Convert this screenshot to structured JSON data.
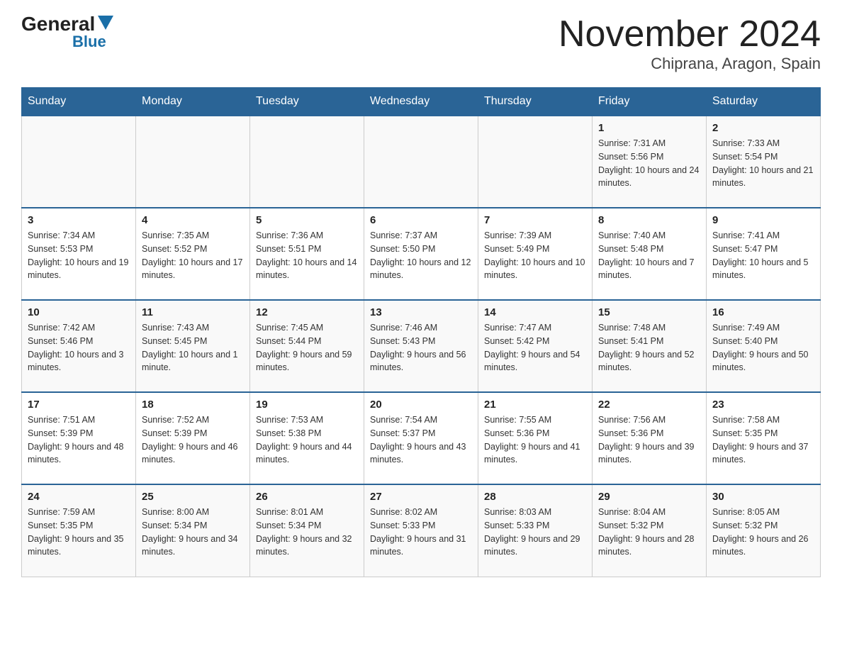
{
  "header": {
    "logo_general": "General",
    "logo_blue": "Blue",
    "title": "November 2024",
    "subtitle": "Chiprana, Aragon, Spain"
  },
  "days_of_week": [
    "Sunday",
    "Monday",
    "Tuesday",
    "Wednesday",
    "Thursday",
    "Friday",
    "Saturday"
  ],
  "weeks": [
    [
      {
        "day": "",
        "info": ""
      },
      {
        "day": "",
        "info": ""
      },
      {
        "day": "",
        "info": ""
      },
      {
        "day": "",
        "info": ""
      },
      {
        "day": "",
        "info": ""
      },
      {
        "day": "1",
        "info": "Sunrise: 7:31 AM\nSunset: 5:56 PM\nDaylight: 10 hours and 24 minutes."
      },
      {
        "day": "2",
        "info": "Sunrise: 7:33 AM\nSunset: 5:54 PM\nDaylight: 10 hours and 21 minutes."
      }
    ],
    [
      {
        "day": "3",
        "info": "Sunrise: 7:34 AM\nSunset: 5:53 PM\nDaylight: 10 hours and 19 minutes."
      },
      {
        "day": "4",
        "info": "Sunrise: 7:35 AM\nSunset: 5:52 PM\nDaylight: 10 hours and 17 minutes."
      },
      {
        "day": "5",
        "info": "Sunrise: 7:36 AM\nSunset: 5:51 PM\nDaylight: 10 hours and 14 minutes."
      },
      {
        "day": "6",
        "info": "Sunrise: 7:37 AM\nSunset: 5:50 PM\nDaylight: 10 hours and 12 minutes."
      },
      {
        "day": "7",
        "info": "Sunrise: 7:39 AM\nSunset: 5:49 PM\nDaylight: 10 hours and 10 minutes."
      },
      {
        "day": "8",
        "info": "Sunrise: 7:40 AM\nSunset: 5:48 PM\nDaylight: 10 hours and 7 minutes."
      },
      {
        "day": "9",
        "info": "Sunrise: 7:41 AM\nSunset: 5:47 PM\nDaylight: 10 hours and 5 minutes."
      }
    ],
    [
      {
        "day": "10",
        "info": "Sunrise: 7:42 AM\nSunset: 5:46 PM\nDaylight: 10 hours and 3 minutes."
      },
      {
        "day": "11",
        "info": "Sunrise: 7:43 AM\nSunset: 5:45 PM\nDaylight: 10 hours and 1 minute."
      },
      {
        "day": "12",
        "info": "Sunrise: 7:45 AM\nSunset: 5:44 PM\nDaylight: 9 hours and 59 minutes."
      },
      {
        "day": "13",
        "info": "Sunrise: 7:46 AM\nSunset: 5:43 PM\nDaylight: 9 hours and 56 minutes."
      },
      {
        "day": "14",
        "info": "Sunrise: 7:47 AM\nSunset: 5:42 PM\nDaylight: 9 hours and 54 minutes."
      },
      {
        "day": "15",
        "info": "Sunrise: 7:48 AM\nSunset: 5:41 PM\nDaylight: 9 hours and 52 minutes."
      },
      {
        "day": "16",
        "info": "Sunrise: 7:49 AM\nSunset: 5:40 PM\nDaylight: 9 hours and 50 minutes."
      }
    ],
    [
      {
        "day": "17",
        "info": "Sunrise: 7:51 AM\nSunset: 5:39 PM\nDaylight: 9 hours and 48 minutes."
      },
      {
        "day": "18",
        "info": "Sunrise: 7:52 AM\nSunset: 5:39 PM\nDaylight: 9 hours and 46 minutes."
      },
      {
        "day": "19",
        "info": "Sunrise: 7:53 AM\nSunset: 5:38 PM\nDaylight: 9 hours and 44 minutes."
      },
      {
        "day": "20",
        "info": "Sunrise: 7:54 AM\nSunset: 5:37 PM\nDaylight: 9 hours and 43 minutes."
      },
      {
        "day": "21",
        "info": "Sunrise: 7:55 AM\nSunset: 5:36 PM\nDaylight: 9 hours and 41 minutes."
      },
      {
        "day": "22",
        "info": "Sunrise: 7:56 AM\nSunset: 5:36 PM\nDaylight: 9 hours and 39 minutes."
      },
      {
        "day": "23",
        "info": "Sunrise: 7:58 AM\nSunset: 5:35 PM\nDaylight: 9 hours and 37 minutes."
      }
    ],
    [
      {
        "day": "24",
        "info": "Sunrise: 7:59 AM\nSunset: 5:35 PM\nDaylight: 9 hours and 35 minutes."
      },
      {
        "day": "25",
        "info": "Sunrise: 8:00 AM\nSunset: 5:34 PM\nDaylight: 9 hours and 34 minutes."
      },
      {
        "day": "26",
        "info": "Sunrise: 8:01 AM\nSunset: 5:34 PM\nDaylight: 9 hours and 32 minutes."
      },
      {
        "day": "27",
        "info": "Sunrise: 8:02 AM\nSunset: 5:33 PM\nDaylight: 9 hours and 31 minutes."
      },
      {
        "day": "28",
        "info": "Sunrise: 8:03 AM\nSunset: 5:33 PM\nDaylight: 9 hours and 29 minutes."
      },
      {
        "day": "29",
        "info": "Sunrise: 8:04 AM\nSunset: 5:32 PM\nDaylight: 9 hours and 28 minutes."
      },
      {
        "day": "30",
        "info": "Sunrise: 8:05 AM\nSunset: 5:32 PM\nDaylight: 9 hours and 26 minutes."
      }
    ]
  ]
}
